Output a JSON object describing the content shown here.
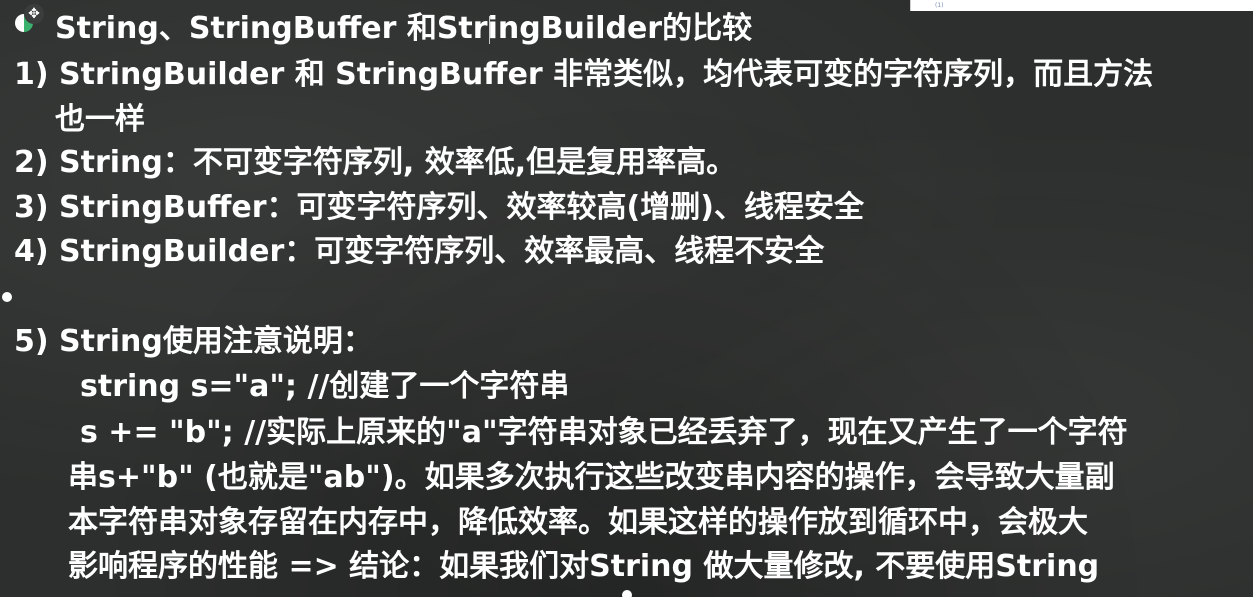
{
  "slide": {
    "title": "String、StringBuffer 和StringBuilder的比较",
    "lines": [
      "1) StringBuilder 和 StringBuffer 非常类似，均代表可变的字符序列，而且方法",
      "也一样",
      "2) String：不可变字符序列, 效率低,但是复用率高。",
      "3) StringBuffer：可变字符序列、效率较高(增删)、线程安全",
      "4) StringBuilder：可变字符序列、效率最高、线程不安全",
      "5) String使用注意说明：",
      "string s=\"a\"; //创建了一个字符串",
      "s += \"b\"; //实际上原来的\"a\"字符串对象已经丢弃了，现在又产生了一个字符",
      "串s+\"b\" (也就是\"ab\")。如果多次执行这些改变串内容的操作，会导致大量副",
      "本字符串对象存留在内存中，降低效率。如果这样的操作放到循环中，会极大",
      "影响程序的性能 => 结论：如果我们对String 做大量修改, 不要使用String"
    ]
  },
  "corner": {
    "mark": "(1)"
  },
  "icons": {
    "cursor": "move-cursor-icon",
    "bullet": "green-bullet-icon"
  },
  "colors": {
    "background": "#2d2f2e",
    "text": "#ffffff",
    "bullet_accent": "#3ab26e"
  }
}
